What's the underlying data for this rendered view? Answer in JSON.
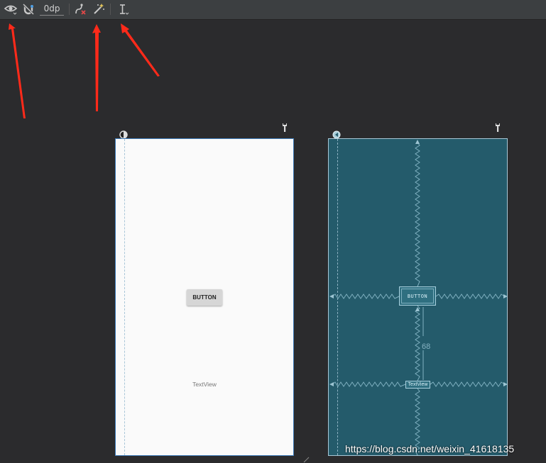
{
  "toolbar": {
    "icons": [
      "eye-icon",
      "magnet-icon",
      "clear-constraints-icon",
      "infer-constraints-icon",
      "guidelines-icon"
    ],
    "default_margin_value": "0dp"
  },
  "design_view": {
    "button_label": "BUTTON",
    "textview_label": "TextView"
  },
  "blueprint_view": {
    "button_label": "BUTTON",
    "textview_label": "TextView",
    "spacing_value": "68"
  },
  "colors": {
    "toolbar_bg": "#3c3f41",
    "canvas_bg": "#2b2b2d",
    "blueprint_bg": "#245b6b",
    "annotation_arrow": "#ff2a1a"
  },
  "watermark": "https://blog.csdn.net/weixin_41618135"
}
